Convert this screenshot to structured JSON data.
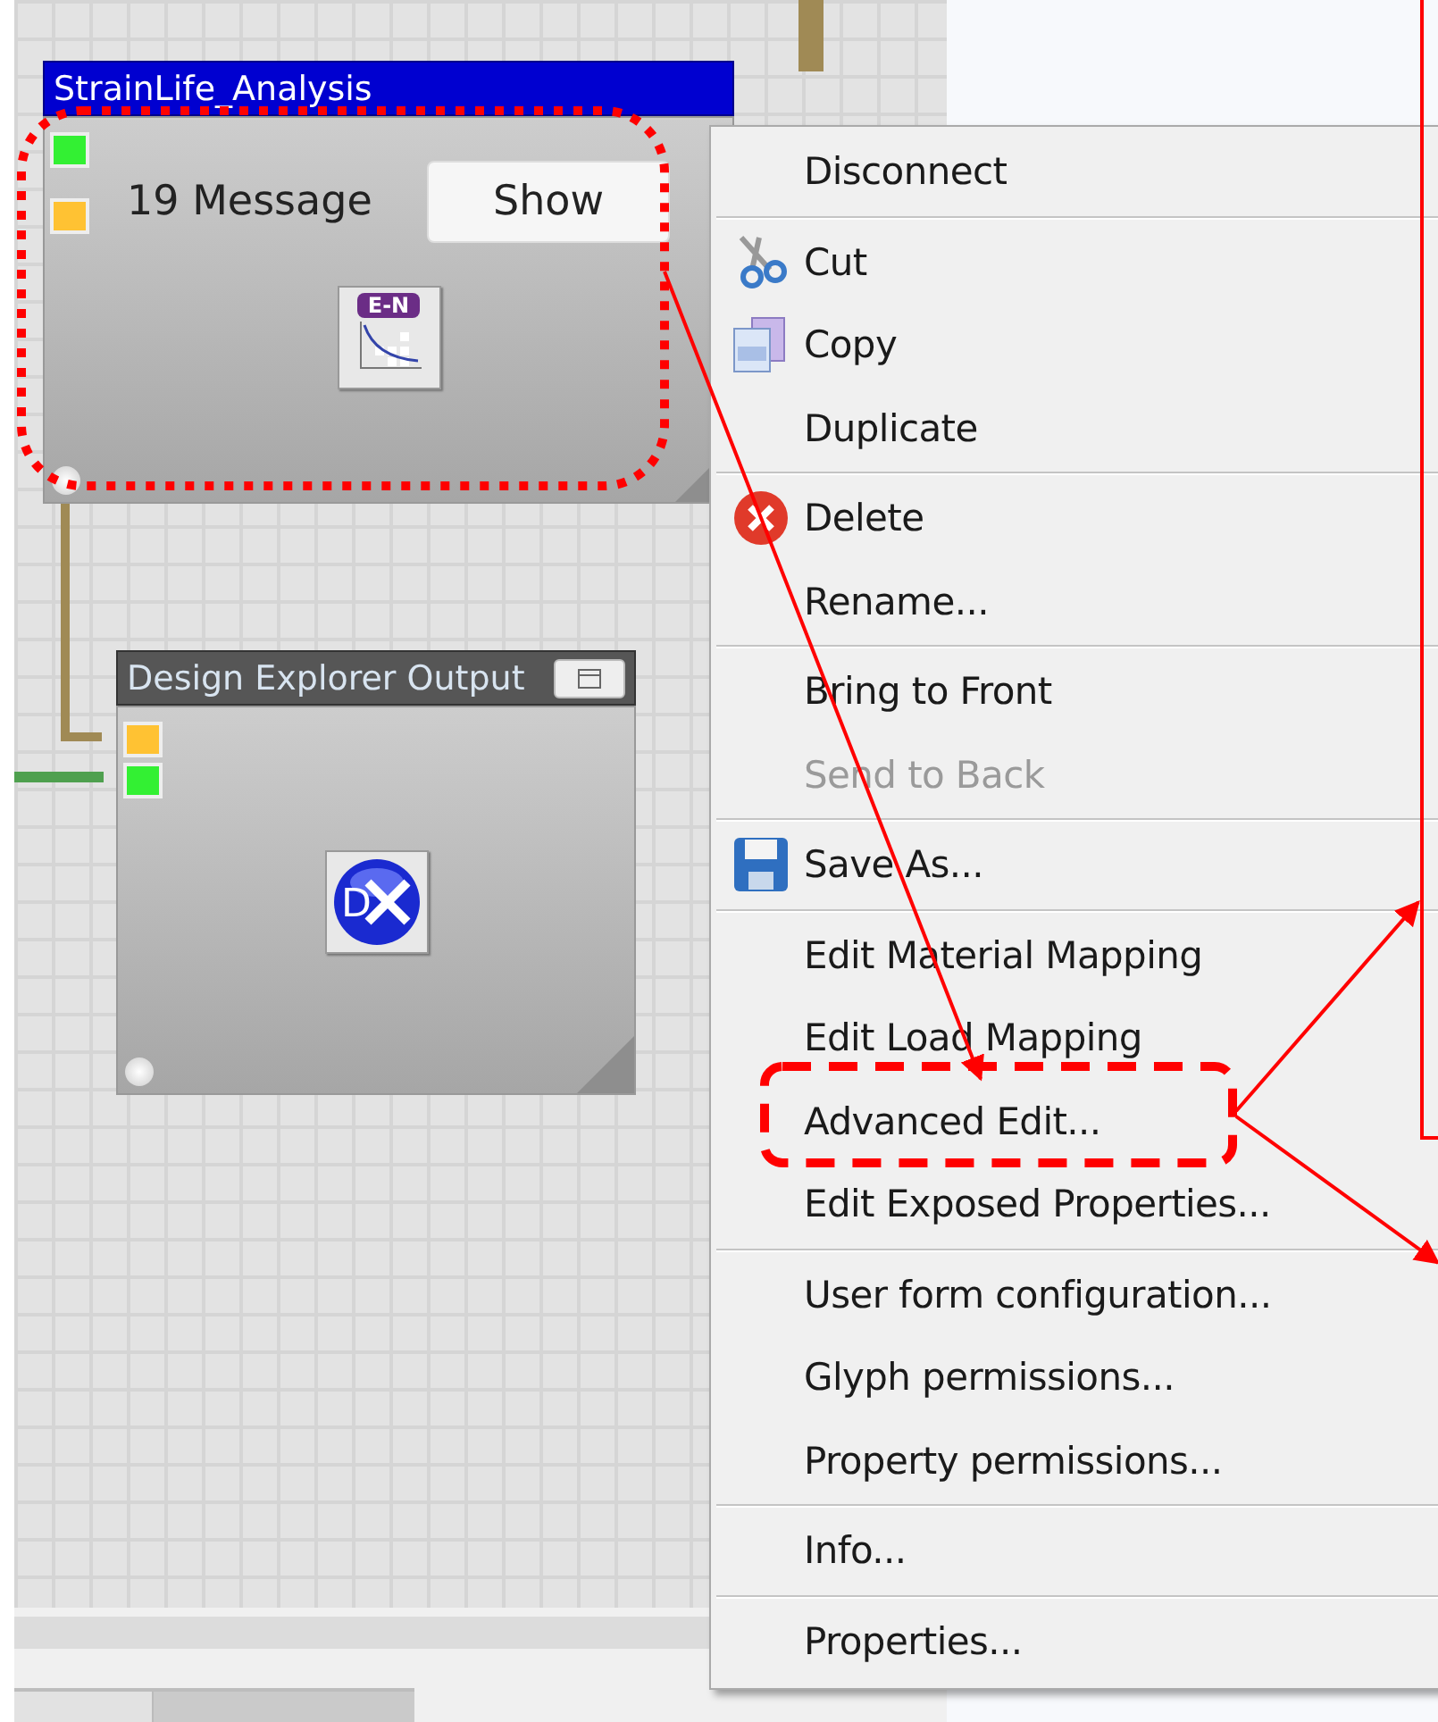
{
  "nodes": [
    {
      "title": "StrainLife_Analysis",
      "selected": true,
      "message": "19 Message",
      "button": "Show",
      "icon_label": "E-N",
      "kind": "strain",
      "ports": [
        {
          "color": "#33f033"
        },
        {
          "color": "#ffc233"
        }
      ]
    },
    {
      "title": "Design Explorer Output",
      "selected": false,
      "icon_label": "D",
      "kind": "explorer",
      "ports": [
        {
          "color": "#ffc233"
        },
        {
          "color": "#33f033"
        }
      ]
    }
  ],
  "context_menu": {
    "groups": [
      [
        {
          "label": "Disconnect",
          "kind": "plain",
          "disabled": false
        }
      ],
      [
        {
          "label": "Cut",
          "kind": "cut",
          "disabled": false
        },
        {
          "label": "Copy",
          "kind": "copy",
          "disabled": false
        },
        {
          "label": "Duplicate",
          "kind": "plain",
          "disabled": false
        }
      ],
      [
        {
          "label": "Delete",
          "kind": "delete",
          "disabled": false
        },
        {
          "label": "Rename...",
          "kind": "plain",
          "disabled": false
        }
      ],
      [
        {
          "label": "Bring to Front",
          "kind": "plain",
          "disabled": false
        },
        {
          "label": "Send to Back",
          "kind": "plain",
          "disabled": true
        }
      ],
      [
        {
          "label": "Save As...",
          "kind": "save",
          "disabled": false
        }
      ],
      [
        {
          "label": "Edit Material Mapping",
          "kind": "plain",
          "disabled": false
        },
        {
          "label": "Edit Load Mapping",
          "kind": "plain",
          "disabled": false
        },
        {
          "label": "Advanced Edit...",
          "kind": "plain",
          "disabled": false
        },
        {
          "label": "Edit Exposed Properties...",
          "kind": "plain",
          "disabled": false
        }
      ],
      [
        {
          "label": "User form configuration...",
          "kind": "plain",
          "disabled": false
        },
        {
          "label": "Glyph permissions...",
          "kind": "plain",
          "disabled": false
        },
        {
          "label": "Property permissions...",
          "kind": "plain",
          "disabled": false
        }
      ],
      [
        {
          "label": "Info...",
          "kind": "plain",
          "disabled": false
        }
      ],
      [
        {
          "label": "Properties...",
          "kind": "plain",
          "disabled": false
        }
      ]
    ]
  }
}
